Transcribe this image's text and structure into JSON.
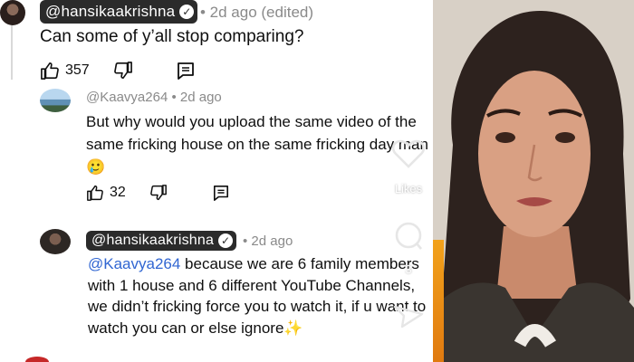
{
  "comments": [
    {
      "author": "@hansikaakrishna",
      "meta": "• 2d ago (edited)",
      "text": "Can some of y’all stop comparing?",
      "likes": "357"
    },
    {
      "author": "@Kaavya264",
      "meta": "• 2d ago",
      "text": "But why would you upload the same video of the same fricking house on the same fricking day man🥲",
      "likes": "32"
    },
    {
      "author": "@hansikaakrishna",
      "meta": "• 2d ago",
      "mention": "@Kaavya264",
      "text": " because we are 6 family members with 1 house and 6 different YouTube Channels, we didn’t fricking force you to watch it, if u want to watch you can or else ignore✨"
    }
  ],
  "overlay": {
    "likes_label": "Likes",
    "comments_count": "3"
  },
  "icons": {
    "like": "thumbs-up-icon",
    "dislike": "thumbs-down-icon",
    "reply": "reply-icon",
    "verified": "verified-check-icon",
    "heart": "heart-icon",
    "comment": "comment-bubble-icon",
    "share": "share-arrow-icon"
  },
  "colors": {
    "mention": "#3166d2",
    "pill": "#2b2b2b",
    "meta": "#8a8a8a"
  }
}
